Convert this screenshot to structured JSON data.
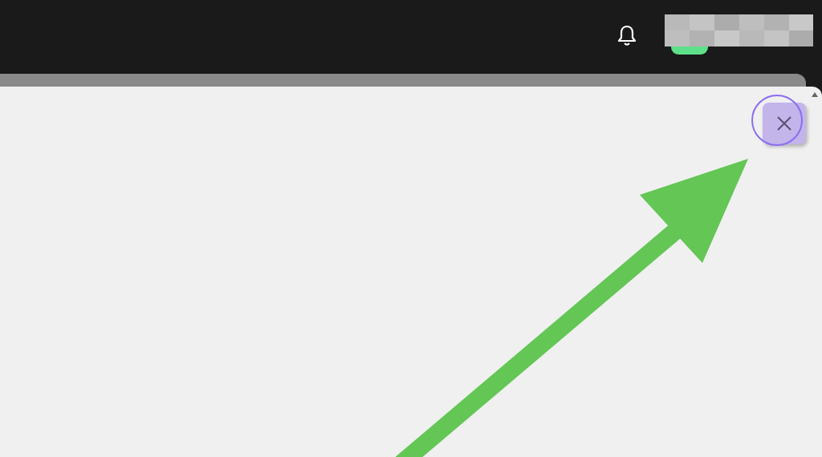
{
  "top_bar": {
    "user_menu": {
      "blurred": true
    }
  },
  "close_button": {
    "highlighted": true
  },
  "annotation": {
    "kind": "arrow"
  }
}
